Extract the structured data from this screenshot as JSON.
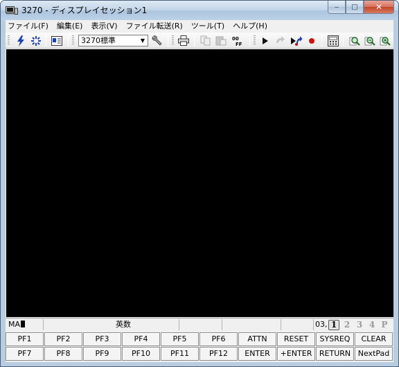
{
  "window": {
    "title": "3270 - ディスプレイセッション1",
    "minimize_glyph": "‒",
    "maximize_glyph": "□",
    "close_glyph": "✕"
  },
  "menu": [
    "ファイル(F)",
    "編集(E)",
    "表示(V)",
    "ファイル転送(R)",
    "ツール(T)",
    "ヘルプ(H)"
  ],
  "toolbar": {
    "emulation_select": "3270標準",
    "icons": [
      "connect-icon",
      "disconnect-icon",
      "session-settings-icon",
      "emulation-select",
      "settings-wrench-icon",
      "print-icon",
      "copy-icon",
      "paste-icon",
      "ooff-icon",
      "play-macro-icon",
      "step-macro-icon",
      "record-step-icon",
      "record-icon",
      "calculator-icon",
      "zoom-in-icon",
      "zoom-out-icon",
      "zoom-fit-icon"
    ]
  },
  "status": {
    "mode": "MA",
    "ime": "英数",
    "position": "03,",
    "pages": [
      "1",
      "2",
      "3",
      "4",
      "P"
    ],
    "active_page": "1"
  },
  "keypad": {
    "row1": [
      "PF1",
      "PF2",
      "PF3",
      "PF4",
      "PF5",
      "PF6",
      "ATTN",
      "RESET",
      "SYSREQ",
      "CLEAR"
    ],
    "row2": [
      "PF7",
      "PF8",
      "PF9",
      "PF10",
      "PF11",
      "PF12",
      "ENTER",
      "+ENTER",
      "RETURN",
      "NextPad"
    ]
  },
  "colors": {
    "screen_bg": "#000000",
    "record_red": "#d01010",
    "icon_blue": "#1a3fbf"
  }
}
